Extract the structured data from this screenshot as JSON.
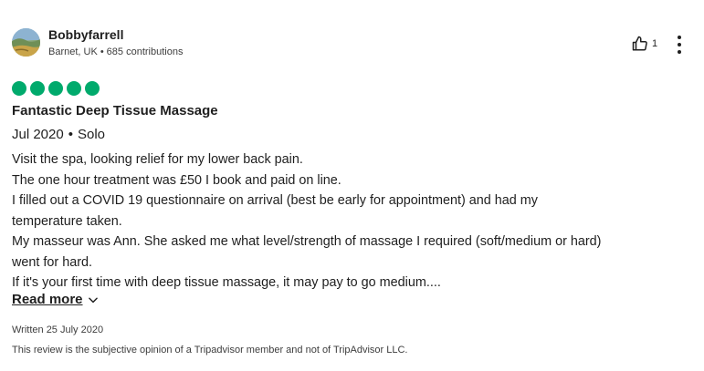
{
  "reviewer": {
    "username": "Bobbyfarrell",
    "location": "Barnet, UK",
    "meta_separator": "•",
    "contributions": "685 contributions",
    "avatar_icon": "user-avatar-photo"
  },
  "actions": {
    "helpful_icon": "thumbs-up-icon",
    "helpful_count": "1",
    "more_icon": "vertical-ellipsis-icon"
  },
  "rating": {
    "value": 5,
    "max": 5,
    "color": "#00aa6c"
  },
  "review": {
    "title": "Fantastic Deep Tissue Massage",
    "date": "Jul 2020",
    "trip_separator": "•",
    "trip_type": "Solo",
    "lines": [
      "Visit the spa, looking relief for my lower back pain.",
      "The one hour treatment was £50 I book and paid on line.",
      "I filled out a COVID 19 questionnaire on arrival (best be early for appointment) and had my",
      "temperature taken.",
      "My masseur was Ann. She asked me what level/strength of massage I required (soft/medium or hard)",
      "went for hard.",
      "If it's your first time with deep tissue massage, it may pay to go medium...."
    ],
    "read_more_label": "Read more",
    "read_more_icon": "chevron-down-icon"
  },
  "footer": {
    "written": "Written 25 July 2020",
    "disclaimer": "This review is the subjective opinion of a Tripadvisor member and not of TripAdvisor LLC."
  }
}
